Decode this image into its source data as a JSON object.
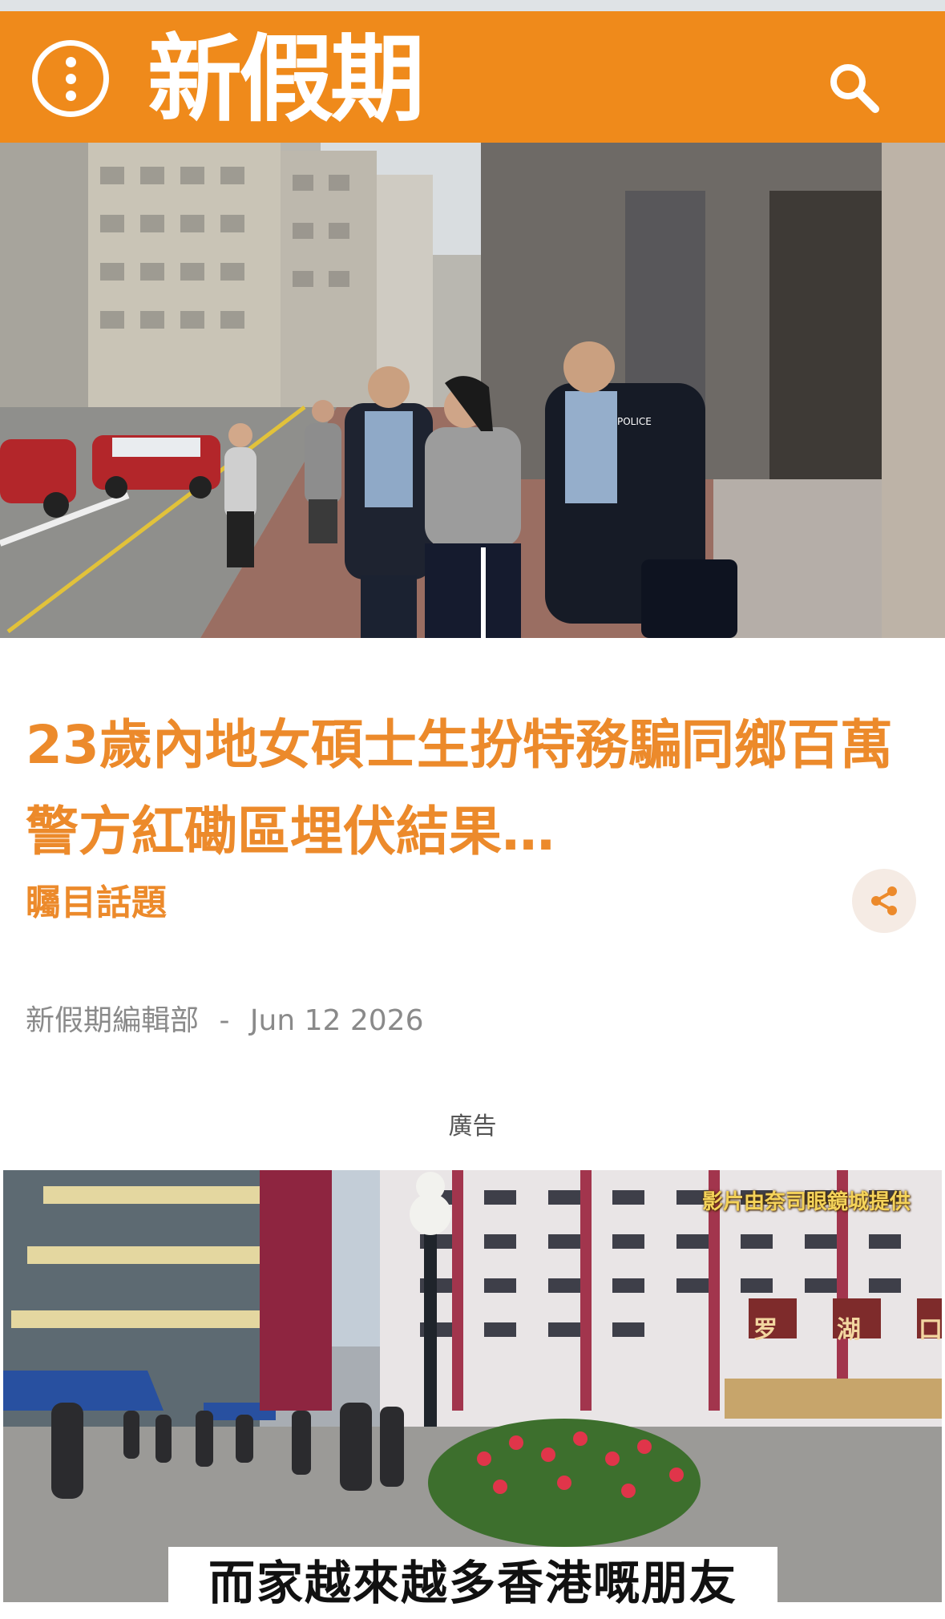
{
  "header": {
    "logo_text": "新假期",
    "menu_icon": "more-vertical-icon",
    "search_icon": "search-icon",
    "brand_color": "#ef8a1b"
  },
  "article": {
    "title": "23歲內地女碩士生扮特務騙同鄉百萬 警方紅磡區埋伏結果…",
    "category": "矚目話題",
    "author": "新假期編輯部",
    "separator": "-",
    "date": "Jun 12 2026",
    "share_icon": "share-icon",
    "accent_color": "#ec8a2b"
  },
  "ad": {
    "label": "廣告",
    "video_credit": "影片由奈司眼鏡城提供",
    "sign_text_1": "罗",
    "sign_text_2": "湖",
    "sign_text_3": "口",
    "subtitle": "而家越來越多香港嘅朋友"
  }
}
